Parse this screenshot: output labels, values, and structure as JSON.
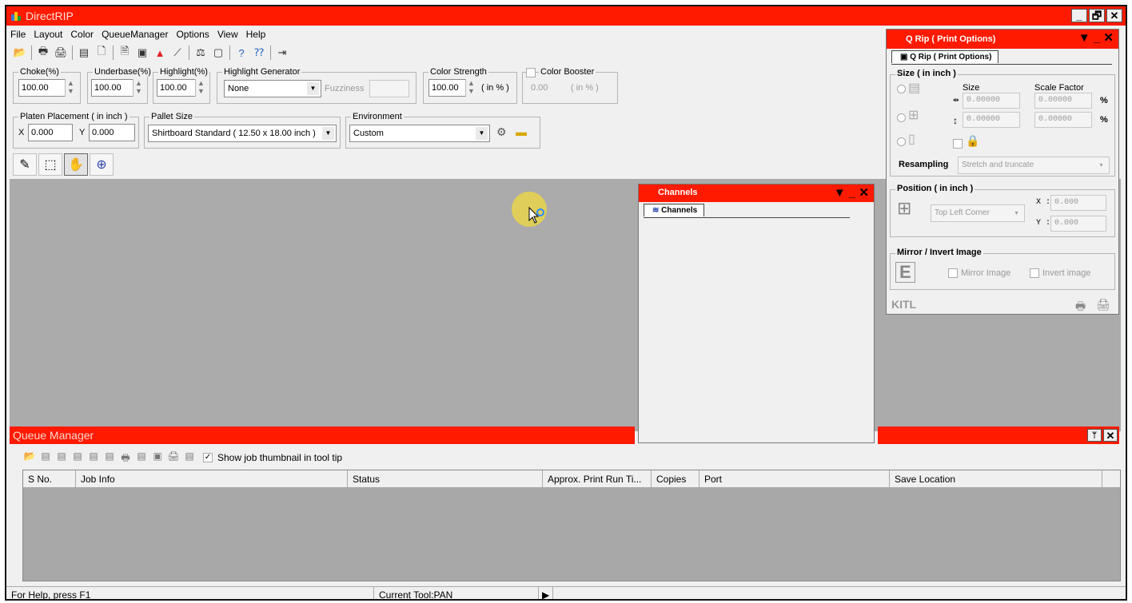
{
  "app": {
    "title": "DirectRIP"
  },
  "window_controls": [
    "_",
    "🗗",
    "✕"
  ],
  "menu": [
    "File",
    "Layout",
    "Color",
    "QueueManager",
    "Options",
    "View",
    "Help"
  ],
  "options": {
    "choke_label": "Choke(%)",
    "choke_value": "100.00",
    "underbase_label": "Underbase(%)",
    "underbase_value": "100.00",
    "highlight_label": "Highlight(%)",
    "highlight_value": "100.00",
    "highlight_gen_label": "Highlight Generator",
    "highlight_gen_value": "None",
    "fuzziness_label": "Fuzziness",
    "color_strength_label": "Color Strength",
    "color_strength_value": "100.00",
    "color_strength_unit": "( in % )",
    "color_booster_label": "Color Booster",
    "color_booster_value": "0.00",
    "color_booster_unit": "( in % )",
    "platen_label": "Platen Placement ( in inch )",
    "x_label": "X",
    "x_value": "0.000",
    "y_label": "Y",
    "y_value": "0.000",
    "pallet_label": "Pallet Size",
    "pallet_value": "Shirtboard Standard ( 12.50 x 18.00 inch )",
    "env_label": "Environment",
    "env_value": "Custom"
  },
  "channels": {
    "title": "Channels",
    "tab": "Channels"
  },
  "qrip": {
    "title": "Q Rip ( Print Options)",
    "tab": "Q Rip ( Print Options)",
    "size_section": "Size ( in inch )",
    "size_col": "Size",
    "scale_col": "Scale Factor",
    "w_size": "0.00000",
    "w_scale": "0.00000",
    "h_size": "0.00000",
    "h_scale": "0.00000",
    "pct": "%",
    "resampling_label": "Resampling",
    "resampling_value": "Stretch and truncate",
    "position_section": "Position ( in inch )",
    "position_value": "Top Left Corner",
    "x_label": "X :",
    "x_value": "0.000",
    "y_label": "Y :",
    "y_value": "0.000",
    "mirror_section": "Mirror / Invert Image",
    "mirror_label": "Mirror Image",
    "invert_label": "Invert image",
    "brand": "KITL"
  },
  "queue": {
    "title": "Queue Manager",
    "thumb_label": "Show job thumbnail in tool tip",
    "columns": [
      "S No.",
      "Job Info",
      "Status",
      "Approx. Print Run Ti...",
      "Copies",
      "Port",
      "Save Location"
    ],
    "pin": "📌"
  },
  "statusbar": {
    "help": "For Help, press F1",
    "tool": "Current Tool:PAN"
  },
  "colors": {
    "accent": "#ff1a00",
    "canvas": "#ababab"
  }
}
